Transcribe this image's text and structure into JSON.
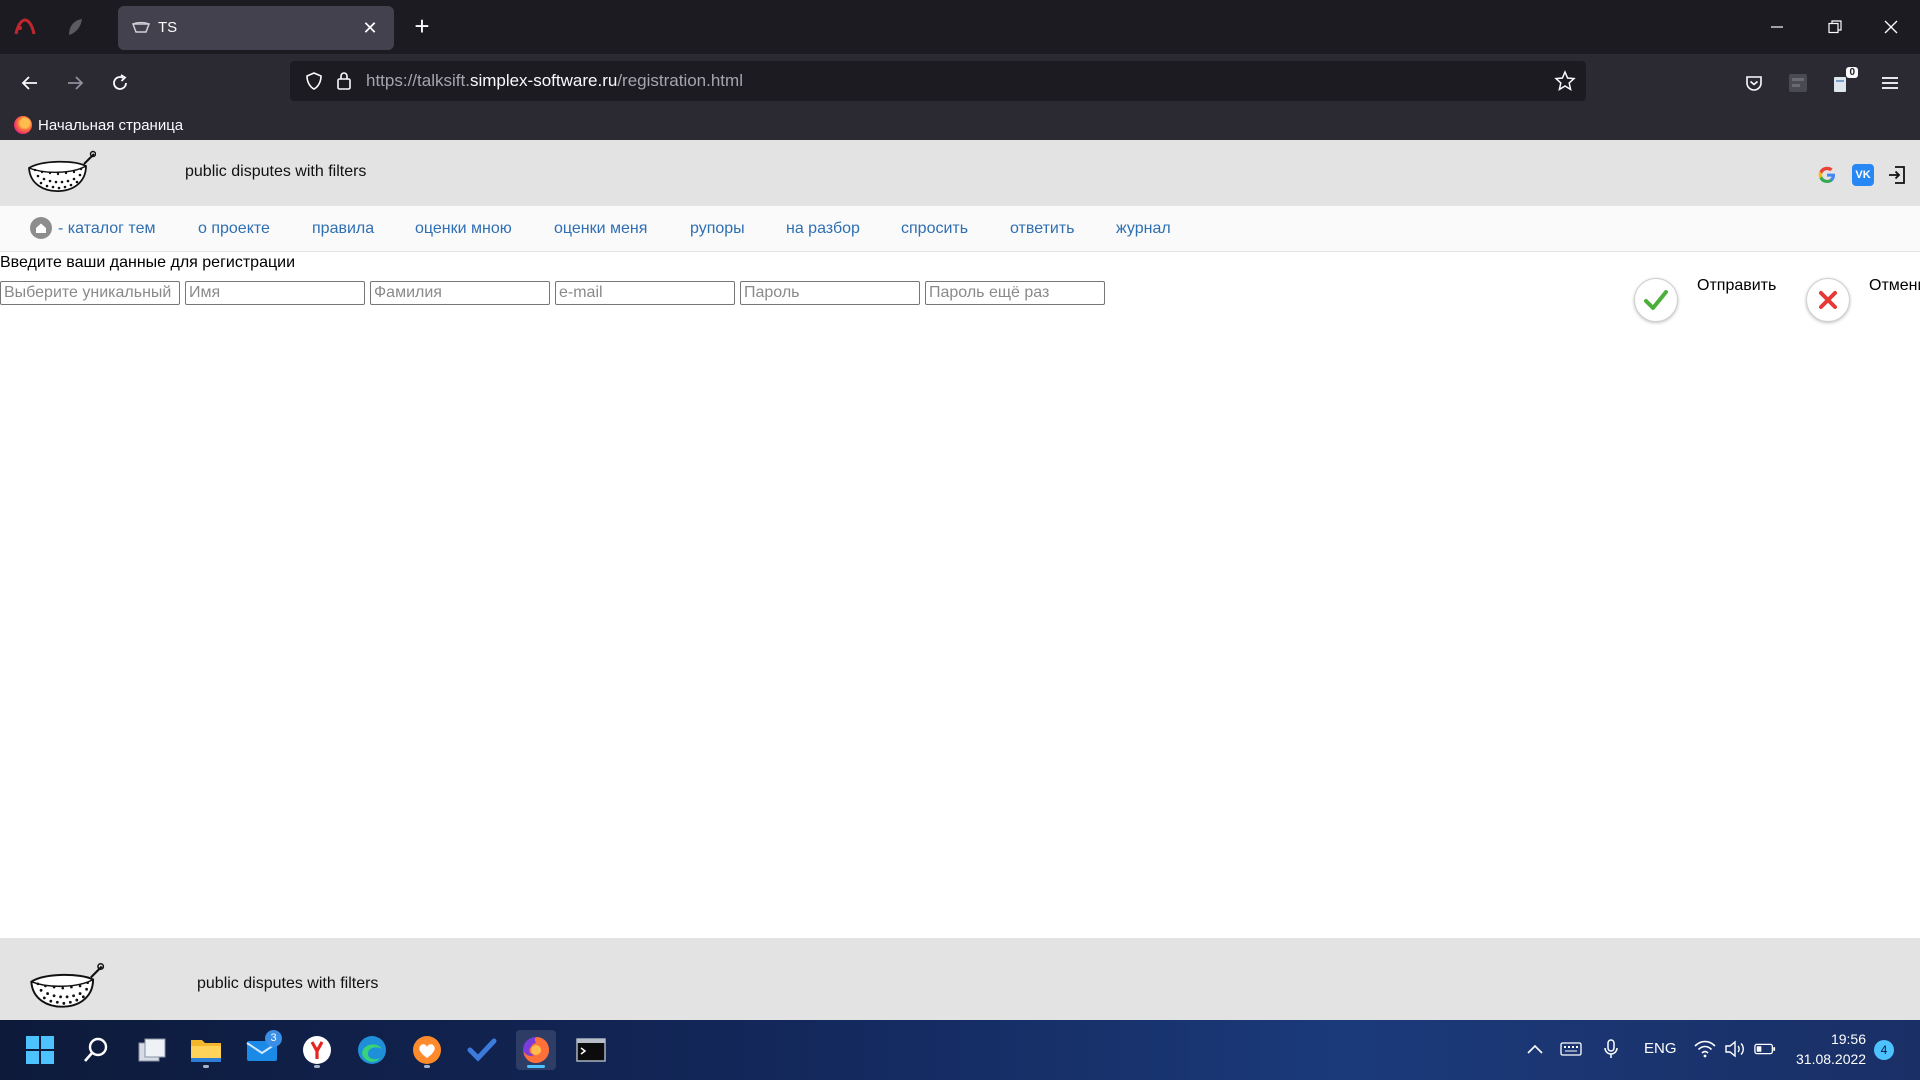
{
  "browser": {
    "tab_title": "TS",
    "url_prefix": "https://talksift.",
    "url_domain": "simplex-software.ru",
    "url_path": "/registration.html",
    "bookmark": "Начальная страница",
    "extension_badge": "0"
  },
  "site": {
    "title": "public disputes with filters",
    "menu": {
      "home": "- каталог тем",
      "about": "о проекте",
      "rules": "правила",
      "my_ratings": "оценки мною",
      "ratings_of_me": "оценки меня",
      "speakers": "рупоры",
      "review": "на разбор",
      "ask": "спросить",
      "answer": "ответить",
      "journal": "журнал"
    },
    "form": {
      "title": "Введите ваши данные для регистрации",
      "login_placeholder": "Выберите уникальный",
      "first_name_placeholder": "Имя",
      "last_name_placeholder": "Фамилия",
      "email_placeholder": "e-mail",
      "password_placeholder": "Пароль",
      "password_repeat_placeholder": "Пароль ещё раз",
      "submit_label": "Отправить",
      "cancel_label": "Отмени"
    },
    "footer_title": "public disputes with filters",
    "colors": {
      "link": "#2f6fb3",
      "header_bg": "#e3e3e3",
      "submit_check": "#4caf3a",
      "cancel_x": "#e53935"
    }
  },
  "taskbar": {
    "mail_badge": "3",
    "language": "ENG",
    "time": "19:56",
    "date": "31.08.2022",
    "notifications": "4"
  }
}
